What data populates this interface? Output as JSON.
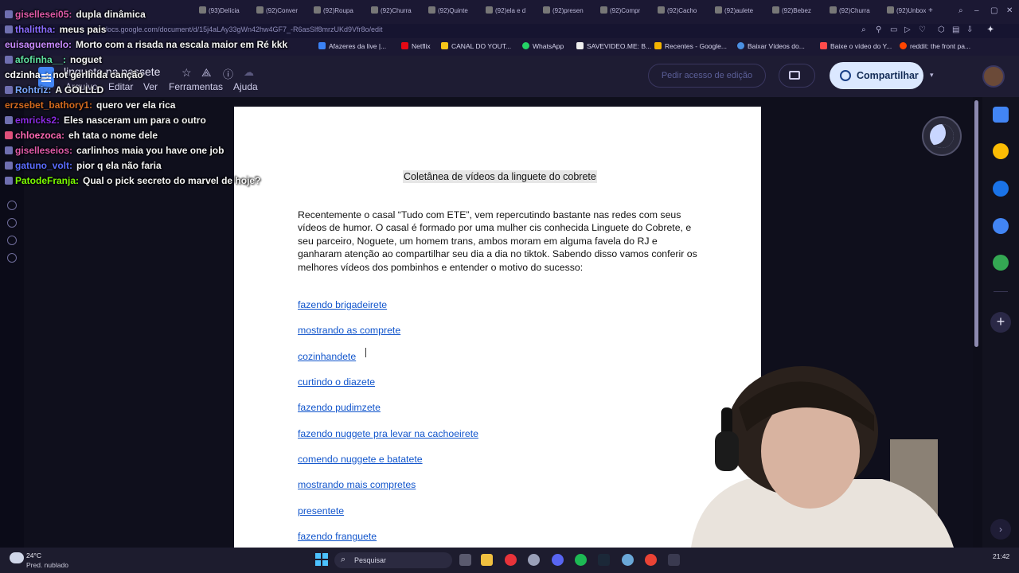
{
  "browser": {
    "tabs": [
      "(93)Delícia",
      "(92)Conver",
      "(92)Roupa",
      "(92)Churra",
      "(92)Quinte",
      "(92)ela e d",
      "(92)presen",
      "(92)Compr",
      "(92)Cacho",
      "(92)aulete",
      "(92)Bebez",
      "(92)Churra",
      "(92)Unbox"
    ],
    "url": "docs.google.com/document/d/15j4aLAy33gWn42hw4GF7_-R6asSlf8mrzUKd9Vfr8o/edit",
    "bookmarks": [
      "Afazeres da live |...",
      "Netflix",
      "CANAL DO YOUT...",
      "WhatsApp",
      "SAVEVIDEO.ME: B...",
      "Recentes - Google...",
      "Baixar Vídeos do...",
      "Baixe o vídeo do Y...",
      "reddit: the front pa..."
    ]
  },
  "docs": {
    "title": "linguete na passete",
    "menu": [
      "Arquivo",
      "Editar",
      "Ver",
      "Ferramentas",
      "Ajuda"
    ],
    "request_edit_label": "Pedir acesso de edição",
    "share_label": "Compartilhar"
  },
  "document": {
    "heading": "Coletânea de vídeos da linguete do cobrete",
    "body": "Recentemente o casal “Tudo com ETE”, vem repercutindo bastante nas redes com seus vídeos de humor. O casal é formado por uma mulher cis conhecida Linguete do Cobrete, e seu parceiro, Noguete, um homem trans, ambos moram em alguma favela do RJ e ganharam atenção ao compartilhar seu dia a dia no tiktok. Sabendo disso vamos conferir os melhores vídeos dos pombinhos e entender o motivo do sucesso:",
    "links": [
      "fazendo brigadeirete",
      "mostrando as comprete",
      "cozinhandete",
      "curtindo o diazete",
      "fazendo pudimzete",
      "fazendo nuggete pra levar na cachoeirete",
      "comendo nuggete e batatete",
      "mostrando mais compretes",
      "presentete",
      "fazendo franguete"
    ]
  },
  "chat": [
    {
      "user": "gisellesei05:",
      "message": "dupla dinâmica",
      "color": "#e05aa8"
    },
    {
      "user": "thalittha:",
      "message": "meus pais",
      "color": "#8a6cff"
    },
    {
      "user": "euisaguemelo:",
      "message": "Morto com a risada na escala maior em Ré kkk",
      "color": "#c98bff"
    },
    {
      "user": "afofinha__:",
      "message": "noguet",
      "color": "#5fe0a0"
    },
    {
      "user": "cdzinha_:",
      "message": "not gerlinda canção",
      "color": "#ffffff"
    },
    {
      "user": "Rohtriz:",
      "message": "A GOLLLD",
      "color": "#7aa8ff"
    },
    {
      "user": "erzsebet_bathory1:",
      "message": "quero ver ela rica",
      "color": "#d2691e"
    },
    {
      "user": "emricks2:",
      "message": "Eles nasceram um para o outro",
      "color": "#8a2be2"
    },
    {
      "user": "chloezoca:",
      "message": "eh tata o nome dele",
      "color": "#ff69b4"
    },
    {
      "user": "giselleseios:",
      "message": "carlinhos maia you have one job",
      "color": "#e05aa8"
    },
    {
      "user": "gatuno_volt:",
      "message": "pior q ela não faria",
      "color": "#5a6cff"
    },
    {
      "user": "PatodeFranja:",
      "message": "Qual o pick secreto do marvel de hoje?",
      "color": "#7cfc00"
    }
  ],
  "taskbar": {
    "weather_temp": "24°C",
    "weather_desc": "Pred. nublado",
    "search_label": "Pesquisar",
    "clock": "21:42"
  },
  "colors": {
    "link": "#1155cc",
    "share_bg": "#dbe8ff",
    "page_bg": "#ffffff",
    "canvas_bg": "#0f0f1c"
  }
}
